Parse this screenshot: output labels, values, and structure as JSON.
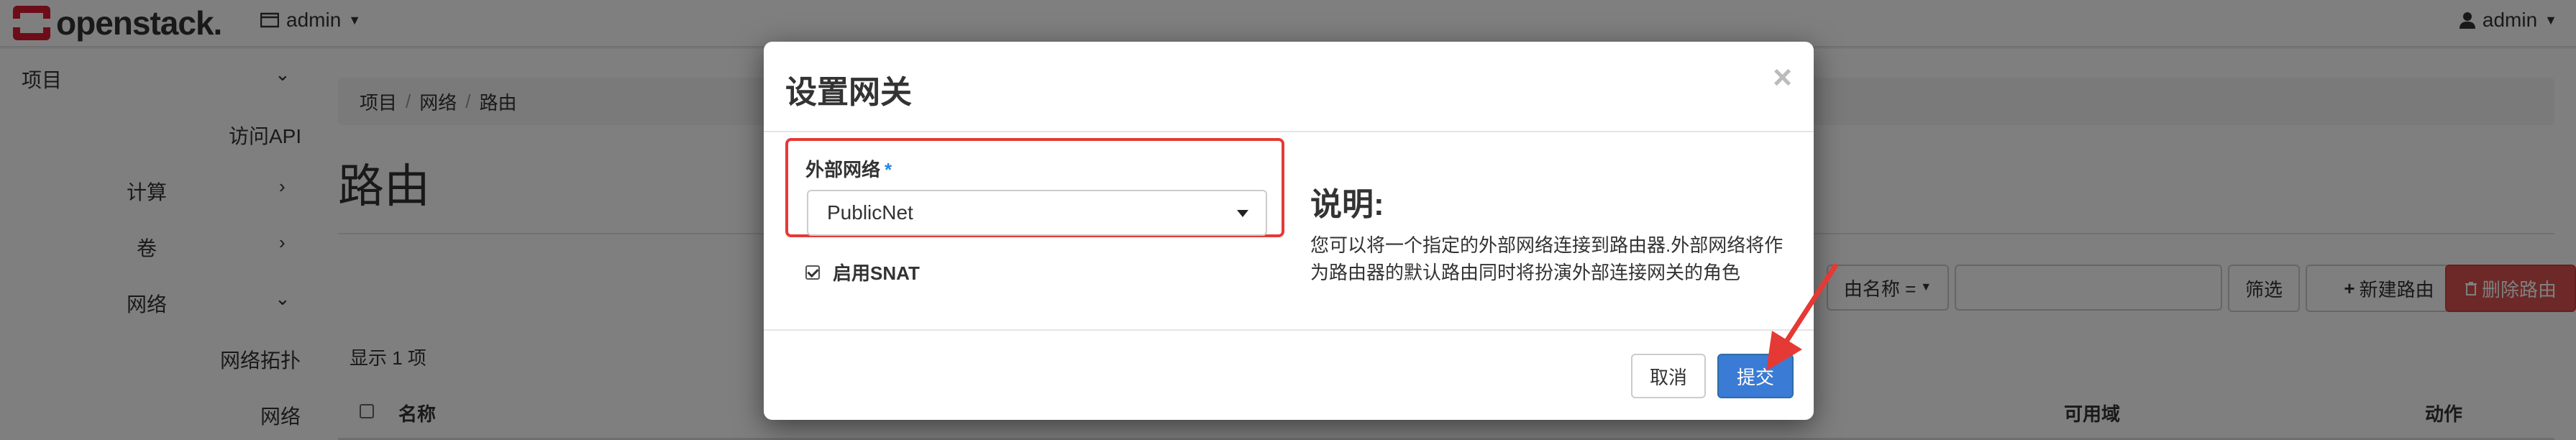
{
  "navbar": {
    "brand": "openstack.",
    "project": "admin",
    "user": "admin"
  },
  "sidebar": {
    "items": [
      {
        "label": "项目"
      },
      {
        "label": "访问API"
      },
      {
        "label": "计算"
      },
      {
        "label": "卷"
      },
      {
        "label": "网络"
      },
      {
        "label": "网络拓扑"
      },
      {
        "label": "网络"
      }
    ]
  },
  "breadcrumb": [
    "项目",
    "网络",
    "路由"
  ],
  "page": {
    "title": "路由",
    "count_text": "显示 1 项"
  },
  "toolbar": {
    "filter_select": "由名称 =",
    "filter_button": "筛选",
    "create_button": "新建路由",
    "delete_button": "删除路由"
  },
  "table": {
    "headers": [
      "名称",
      "可用域",
      "动作"
    ]
  },
  "modal": {
    "title": "设置网关",
    "close": "×",
    "field_label": "外部网络",
    "required_mark": "*",
    "selected_network": "PublicNet",
    "snat_label": "启用SNAT",
    "desc_title": "说明:",
    "desc_text": "您可以将一个指定的外部网络连接到路由器.外部网络将作为路由器的默认路由同时将扮演外部连接网关的角色",
    "cancel": "取消",
    "submit": "提交"
  },
  "colors": {
    "highlight": "#e53935",
    "primary": "#3a7bd5",
    "danger": "#d9534f",
    "required": "#1e88e5"
  }
}
